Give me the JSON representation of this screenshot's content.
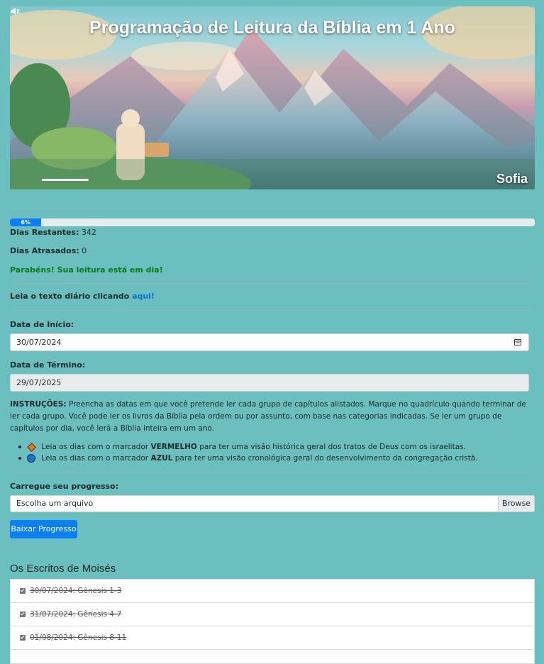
{
  "banner": {
    "title": "Programação de Leitura da Bíblia em 1 Ano",
    "user": "Sofia"
  },
  "progress": {
    "percent": 6,
    "label": "6%"
  },
  "stats": {
    "remaining_label": "Dias Restantes:",
    "remaining_value": "342",
    "late_label": "Dias Atrasados:",
    "late_value": "0",
    "status": "Parabéns! Sua leitura está em dia!"
  },
  "daily": {
    "text": "Leia o texto diário clicando",
    "link": "aqui!"
  },
  "start": {
    "label": "Data de Início:",
    "value": "30/07/2024"
  },
  "end": {
    "label": "Data de Término:",
    "value": "29/07/2025"
  },
  "instructions": {
    "head": "INSTRUÇÕES:",
    "body": "Preencha as datas em que você pretende ler cada grupo de capítulos alistados. Marque no quadrículo quando terminar de ler cada grupo. Você pode ler os livros da Bíblia pela ordem ou por assunto, com base nas categorias indicadas. Se ler um grupo de capítulos por dia, você lerá a Bíblia inteira em um ano.",
    "red_pre": "Leia os dias com o marcador",
    "red_word": "VERMELHO",
    "red_post": "para ter uma visão histórica geral dos tratos de Deus com os israelitas.",
    "blue_pre": "Leia os dias com o marcador",
    "blue_word": "AZUL",
    "blue_post": "para ter uma visão cronológica geral do desenvolvimento da congregação cristã."
  },
  "upload": {
    "label": "Carregue seu progresso:",
    "placeholder": "Escolha um arquivo",
    "browse": "Browse",
    "download_button": "Baixar Progresso"
  },
  "section": {
    "title": "Os Escritos de Moisés",
    "items": [
      {
        "text": "30/07/2024: Gênesis 1-3",
        "checked": true
      },
      {
        "text": "31/07/2024: Gênesis 4-7",
        "checked": true
      },
      {
        "text": "01/08/2024: Gênesis 8-11",
        "checked": true
      }
    ]
  }
}
